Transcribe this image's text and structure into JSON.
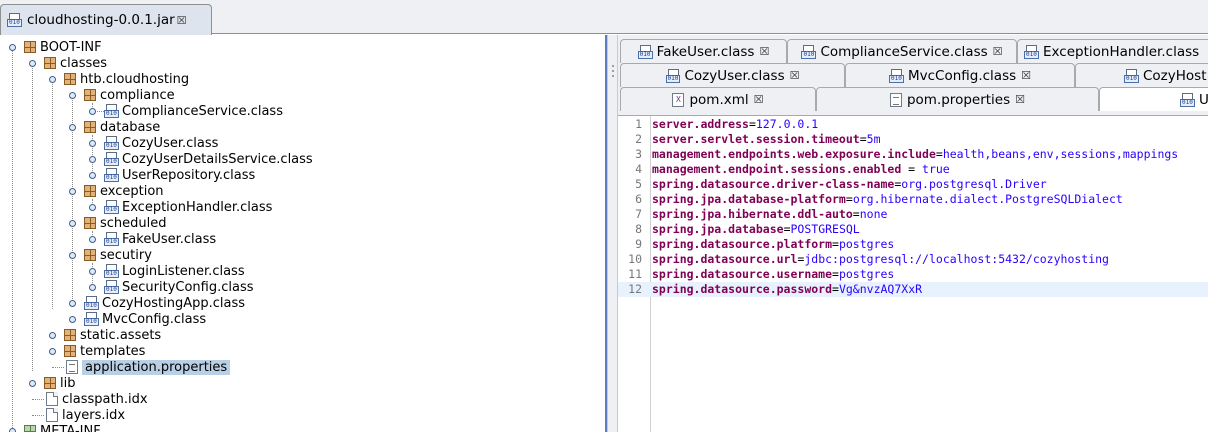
{
  "window_tab": {
    "title": "cloudhosting-0.0.1.jar"
  },
  "tree": {
    "boot_inf": "BOOT-INF",
    "classes": "classes",
    "htb_cloudhosting": "htb.cloudhosting",
    "compliance": "compliance",
    "compliance_service": "ComplianceService.class",
    "database": "database",
    "cozy_user": "CozyUser.class",
    "cozy_user_details": "CozyUserDetailsService.class",
    "user_repository": "UserRepository.class",
    "exception": "exception",
    "exception_handler": "ExceptionHandler.class",
    "scheduled": "scheduled",
    "fake_user": "FakeUser.class",
    "secutiry": "secutiry",
    "login_listener": "LoginListener.class",
    "security_config": "SecurityConfig.class",
    "cozy_hosting_app": "CozyHostingApp.class",
    "mvc_config": "MvcConfig.class",
    "static_assets": "static.assets",
    "templates": "templates",
    "application_properties": "application.properties",
    "lib": "lib",
    "classpath_idx": "classpath.idx",
    "layers_idx": "layers.idx",
    "meta_inf": "META-INF"
  },
  "editor_tabs": {
    "row1": [
      "FakeUser.class",
      "ComplianceService.class",
      "ExceptionHandler.class"
    ],
    "row2": [
      "CozyUser.class",
      "MvcConfig.class",
      "CozyHost"
    ],
    "row3": [
      "pom.xml",
      "pom.properties",
      "U"
    ]
  },
  "code_lines": [
    {
      "num": "1",
      "key": "server.address",
      "sep": "=",
      "val": "127.0.0.1"
    },
    {
      "num": "2",
      "key": "server.servlet.session.timeout",
      "sep": "=",
      "val": "5m"
    },
    {
      "num": "3",
      "key": "management.endpoints.web.exposure.include",
      "sep": "=",
      "val": "health,beans,env,sessions,mappings"
    },
    {
      "num": "4",
      "key": "management.endpoint.sessions.enabled",
      "sep": " = ",
      "val": "true"
    },
    {
      "num": "5",
      "key": "spring.datasource.driver-class-name",
      "sep": "=",
      "val": "org.postgresql.Driver"
    },
    {
      "num": "6",
      "key": "spring.jpa.database-platform",
      "sep": "=",
      "val": "org.hibernate.dialect.PostgreSQLDialect"
    },
    {
      "num": "7",
      "key": "spring.jpa.hibernate.ddl-auto",
      "sep": "=",
      "val": "none"
    },
    {
      "num": "8",
      "key": "spring.jpa.database",
      "sep": "=",
      "val": "POSTGRESQL"
    },
    {
      "num": "9",
      "key": "spring.datasource.platform",
      "sep": "=",
      "val": "postgres"
    },
    {
      "num": "10",
      "key": "spring.datasource.url",
      "sep": "=",
      "val": "jdbc:postgresql://localhost:5432/cozyhosting"
    },
    {
      "num": "11",
      "key": "spring.datasource.username",
      "sep": "=",
      "val": "postgres"
    },
    {
      "num": "12",
      "key": "spring.datasource.password",
      "sep": "=",
      "val": "Vg&nvzAQ7XxR"
    }
  ]
}
